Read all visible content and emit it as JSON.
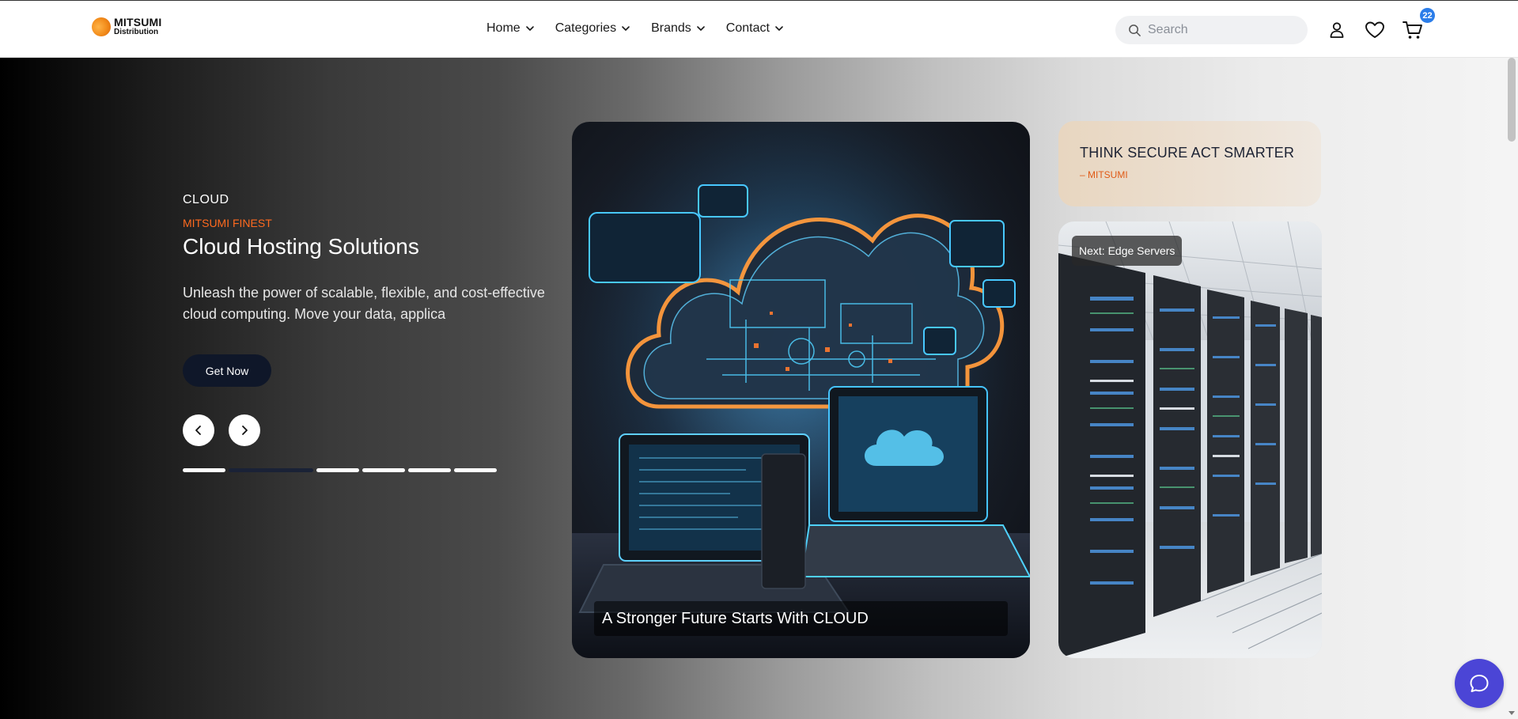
{
  "brand": {
    "line1": "MITSUMI",
    "line2": "Distribution"
  },
  "nav": {
    "items": [
      {
        "label": "Home"
      },
      {
        "label": "Categories"
      },
      {
        "label": "Brands"
      },
      {
        "label": "Contact"
      }
    ]
  },
  "search": {
    "placeholder": "Search",
    "value": ""
  },
  "header_icons": {
    "account": "user-icon",
    "wishlist": "heart-icon",
    "cart": "cart-icon"
  },
  "cart": {
    "count": "22"
  },
  "hero": {
    "kicker": "CLOUD",
    "subkicker": "MITSUMI FINEST",
    "title": "Cloud Hosting Solutions",
    "description": "Unleash the power of scalable, flexible, and cost-effective cloud computing. Move your data, applica",
    "cta_label": "Get Now",
    "slide_count": 6,
    "active_slide": 2
  },
  "main_card": {
    "caption": "A Stronger Future Starts With CLOUD"
  },
  "quote_card": {
    "title": "THINK SECURE ACT SMARTER",
    "attribution": "– MITSUMI"
  },
  "next_card": {
    "label": "Next: Edge Servers"
  },
  "colors": {
    "accent_orange": "#ff6a1f",
    "cta_navy": "#0f1729",
    "chat_purple": "#4b45d6",
    "badge_blue": "#2b7de9"
  }
}
